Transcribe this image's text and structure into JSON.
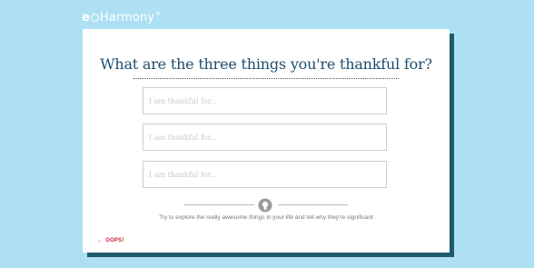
{
  "brand": {
    "prefix": "e",
    "mid": "H",
    "rest": "armony",
    "reg": "®"
  },
  "question": {
    "title": "What are the three things you're thankful for?"
  },
  "inputs": [
    {
      "placeholder": "I am thankful for...",
      "value": ""
    },
    {
      "placeholder": "I am thankful for...",
      "value": ""
    },
    {
      "placeholder": "I am thankful for...",
      "value": ""
    }
  ],
  "hint": {
    "text": "Try to explore the really awesome things in your life and tell why they're significant",
    "icon": "lightbulb-icon"
  },
  "back": {
    "arrow": "←",
    "label": "OOPS!"
  },
  "colors": {
    "background": "#aee0f4",
    "title": "#1f4d6e",
    "card_shadow": "#1f5a6e",
    "back_link": "#cc2233"
  }
}
